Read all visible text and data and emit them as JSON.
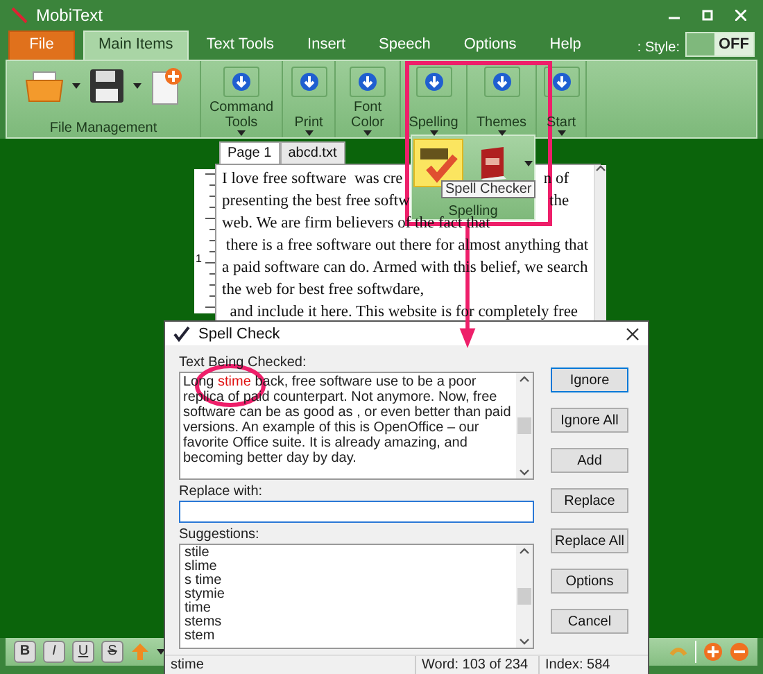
{
  "window": {
    "title": "MobiText"
  },
  "tabs": [
    {
      "label": "File",
      "kind": "file",
      "selected": false
    },
    {
      "label": "Main Items",
      "kind": "tab",
      "selected": true
    },
    {
      "label": "Text Tools",
      "kind": "tab",
      "selected": false
    },
    {
      "label": "Insert",
      "kind": "tab",
      "selected": false
    },
    {
      "label": "Speech",
      "kind": "tab",
      "selected": false
    },
    {
      "label": "Options",
      "kind": "tab",
      "selected": false
    },
    {
      "label": "Help",
      "kind": "tab",
      "selected": false
    }
  ],
  "style_toggle": {
    "label": ": Style:",
    "state": "OFF",
    "on": false
  },
  "ribbon": {
    "file_group": "File Management",
    "buttons": [
      {
        "label": "Command Tools",
        "dropdown": true
      },
      {
        "label": "Print",
        "dropdown": true
      },
      {
        "label": "Font Color",
        "dropdown": true
      },
      {
        "label": "Spelling",
        "dropdown": true
      },
      {
        "label": "Themes",
        "dropdown": true
      },
      {
        "label": "Start",
        "dropdown": true
      }
    ]
  },
  "spelling_menu": {
    "label": "Spelling",
    "tooltip": "Spell Checker",
    "items": [
      {
        "kind": "abc-check",
        "selected": true
      },
      {
        "kind": "book",
        "selected": false
      }
    ]
  },
  "document": {
    "tabs": [
      {
        "label": "Page 1",
        "selected": true
      },
      {
        "label": "abcd.txt",
        "selected": false
      }
    ],
    "ruler_label": "1",
    "lines": [
      [
        "I love free software  was cre",
        "n of"
      ],
      [
        "presenting the best free softw",
        "the"
      ],
      [
        "web. We are firm believers of the fact that"
      ],
      [
        " there is a free software out there for almost anything that"
      ],
      [
        "a paid software can do. Armed with this belief, we search"
      ],
      [
        "the web for best free softwdare,"
      ],
      [
        "  and include it here. This website is for completely free"
      ]
    ]
  },
  "format_buttons": [
    "B",
    "I",
    "U",
    "S"
  ],
  "dialog": {
    "title": "Spell Check",
    "text_label": "Text Being Checked:",
    "checked_text": {
      "before": "Long ",
      "flagged": "stime",
      "after": " back, free software use to be a poor replica of paid counterpart. Not anymore. Now, free software can be as good as , or even better than paid versions. An example of this is OpenOffice – our favorite Office suite. It is already amazing, and becoming better day by day."
    },
    "replace_label": "Replace with:",
    "suggestions_label": "Suggestions:",
    "suggestions": [
      "stile",
      "slime",
      "s time",
      "stymie",
      "time",
      "stems",
      "stem"
    ],
    "buttons": [
      {
        "label": "Ignore",
        "focused": true
      },
      {
        "label": "Ignore All",
        "focused": false
      },
      {
        "label": "Add",
        "focused": false
      },
      {
        "label": "Replace",
        "focused": false
      },
      {
        "label": "Replace All",
        "focused": false
      },
      {
        "label": "Options",
        "focused": false
      },
      {
        "label": "Cancel",
        "focused": false
      }
    ],
    "status": [
      "stime",
      "Word: 103 of 234",
      "Index: 584"
    ]
  }
}
